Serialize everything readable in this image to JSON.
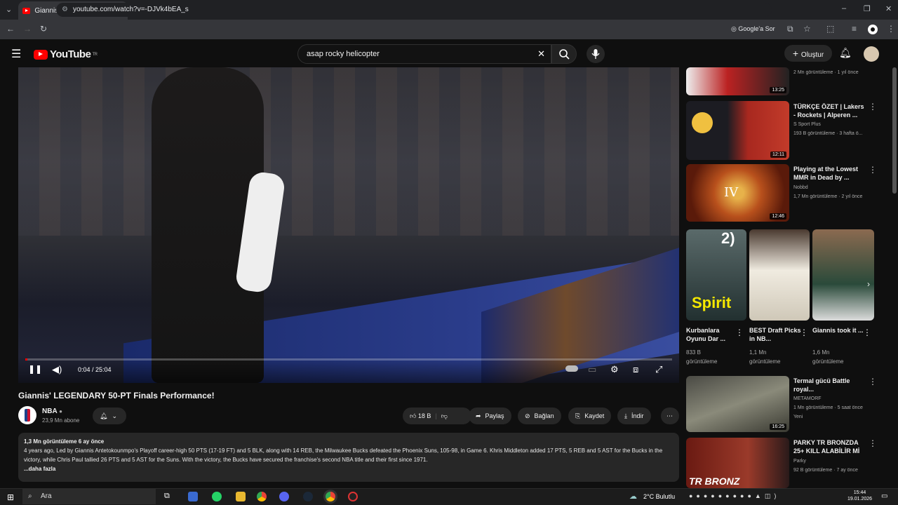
{
  "browser": {
    "tab_title": "Giannis' LEGENDARY 50-PT",
    "url": "youtube.com/watch?v=-DJVk4bEA_s",
    "google_button": "Google'a Sor"
  },
  "header": {
    "logo": "YouTube",
    "region": "TR",
    "search_value": "asap rocky helicopter",
    "create_label": "Oluştur"
  },
  "player": {
    "time": "0:04 / 25:04",
    "progress_fraction": 0.003
  },
  "video": {
    "title": "Giannis' LEGENDARY 50-PT Finals Performance!",
    "channel": "NBA",
    "subscribers": "23,9 Mn abone",
    "likes": "18 B",
    "share_label": "Paylaş",
    "connect_label": "Bağlan",
    "save_label": "Kaydet",
    "download_label": "İndir"
  },
  "description": {
    "meta": "1,3 Mn görüntüleme  6 ay önce",
    "text": "4 years ago, Led by Giannis Antetokounmpo's Playoff career-high 50 PTS (17-19 FT) and 5 BLK, along with 14 REB, the Milwaukee Bucks defeated the Phoenix Suns, 105-98, in Game 6. Khris Middleton added 17 PTS, 5 REB and 5 AST for the Bucks in the victory, while Chris Paul tallied 26 PTS and 5 AST for the Suns. With the victory, the Bucks have secured the franchise's second NBA title and their first since 1971.",
    "more": "...daha fazla"
  },
  "sidebar": {
    "top_partial": {
      "meta": "2 Mn görüntüleme · 1 yıl önce",
      "duration": "13:25"
    },
    "items": [
      {
        "title": "TÜRKÇE ÖZET | Lakers - Rockets | Alperen ...",
        "channel": "S Sport Plus",
        "meta": "193 B görüntüleme · 3 hafta ö...",
        "duration": "12:11"
      },
      {
        "title": "Playing at the Lowest MMR in Dead by ...",
        "channel": "Nobbd",
        "meta": "1,7 Mn görüntüleme · 2 yıl önce",
        "duration": "12:46"
      }
    ],
    "shorts": [
      {
        "title": "Kurbanlara Oyunu Dar ...",
        "meta1": "833 B",
        "meta2": "görüntüleme",
        "overlay": "Spirit",
        "badge": "2)"
      },
      {
        "title": "BEST Draft Picks in NB...",
        "meta1": "1,1 Mn",
        "meta2": "görüntüleme"
      },
      {
        "title": "Giannis took it ...",
        "meta1": "1,6 Mn",
        "meta2": "görüntüleme"
      }
    ],
    "items2": [
      {
        "title": "Termal gücü Battle royal...",
        "channel": "METAMORF",
        "meta": "1 Mn görüntüleme · 5 saat önce",
        "badge": "Yeni",
        "duration": "16:25"
      },
      {
        "title": "PARKY TR BRONZDA 25+ KILL ALABİLİR Mİ",
        "channel": "Parky",
        "meta": "92 B görüntüleme · 7 ay önce",
        "overlay": "TR BRONZ"
      }
    ]
  },
  "taskbar": {
    "search_placeholder": "Ara",
    "weather": "2°C  Bulutlu",
    "time": "15:44",
    "date": "19.01.2026"
  }
}
